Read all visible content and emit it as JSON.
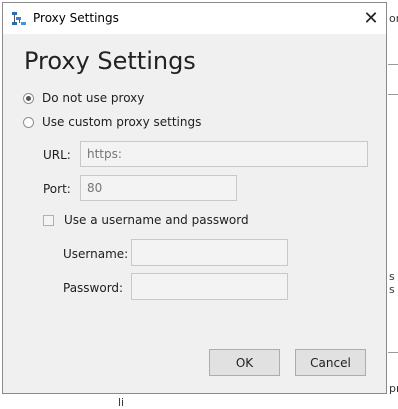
{
  "background": {
    "fragments": [
      "or",
      "s s",
      "pre",
      "li"
    ]
  },
  "dialog": {
    "title": "Proxy Settings",
    "heading": "Proxy Settings",
    "options": [
      {
        "label": "Do not use proxy",
        "checked": true
      },
      {
        "label": "Use custom proxy settings",
        "checked": false
      }
    ],
    "url": {
      "label": "URL:",
      "placeholder": "https:"
    },
    "port": {
      "label": "Port:",
      "placeholder": "80"
    },
    "auth_checkbox": {
      "label": "Use a username and password",
      "checked": false
    },
    "username": {
      "label": "Username:",
      "value": ""
    },
    "password": {
      "label": "Password:",
      "value": ""
    },
    "ok_label": "OK",
    "cancel_label": "Cancel"
  }
}
